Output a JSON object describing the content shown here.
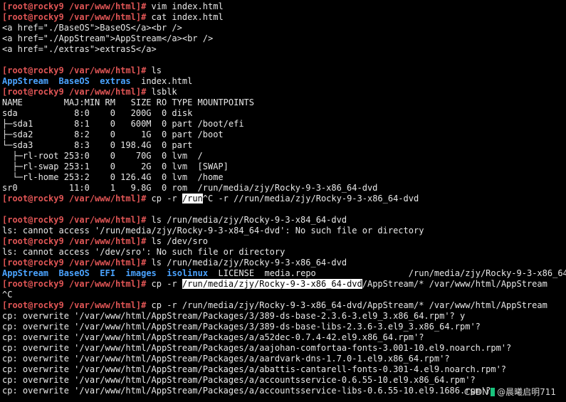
{
  "terminal": {
    "lines": [
      {
        "segments": [
          {
            "text": "[root@rocky9 /var/www/html]#",
            "style": "prompt"
          },
          {
            "text": " vim index.html"
          }
        ]
      },
      {
        "segments": [
          {
            "text": "[root@rocky9 /var/www/html]#",
            "style": "prompt"
          },
          {
            "text": " cat index.html"
          }
        ]
      },
      {
        "segments": [
          {
            "text": "<a href=\"./BaseOS\">BaseOS</a><br />"
          }
        ]
      },
      {
        "segments": [
          {
            "text": "<a href=\"./AppStream\">AppStream</a><br />"
          }
        ]
      },
      {
        "segments": [
          {
            "text": "<a href=\"./extras\">extrasS</a>"
          }
        ]
      },
      {
        "segments": []
      },
      {
        "segments": [
          {
            "text": "[root@rocky9 /var/www/html]#",
            "style": "prompt"
          },
          {
            "text": " ls"
          }
        ]
      },
      {
        "segments": [
          {
            "text": "AppStream",
            "style": "dir"
          },
          {
            "text": "  "
          },
          {
            "text": "BaseOS",
            "style": "dir"
          },
          {
            "text": "  "
          },
          {
            "text": "extras",
            "style": "dir"
          },
          {
            "text": "  index.html"
          }
        ]
      },
      {
        "segments": [
          {
            "text": "[root@rocky9 /var/www/html]#",
            "style": "prompt"
          },
          {
            "text": " lsblk"
          }
        ]
      },
      {
        "segments": [
          {
            "text": "NAME        MAJ:MIN RM   SIZE RO TYPE MOUNTPOINTS"
          }
        ]
      },
      {
        "segments": [
          {
            "text": "sda           8:0    0   200G  0 disk"
          }
        ]
      },
      {
        "segments": [
          {
            "text": "├─sda1        8:1    0   600M  0 part /boot/efi"
          }
        ]
      },
      {
        "segments": [
          {
            "text": "├─sda2        8:2    0     1G  0 part /boot"
          }
        ]
      },
      {
        "segments": [
          {
            "text": "└─sda3        8:3    0 198.4G  0 part"
          }
        ]
      },
      {
        "segments": [
          {
            "text": "  ├─rl-root 253:0    0    70G  0 lvm  /"
          }
        ]
      },
      {
        "segments": [
          {
            "text": "  ├─rl-swap 253:1    0     2G  0 lvm  [SWAP]"
          }
        ]
      },
      {
        "segments": [
          {
            "text": "  └─rl-home 253:2    0 126.4G  0 lvm  /home"
          }
        ]
      },
      {
        "segments": [
          {
            "text": "sr0          11:0    1   9.8G  0 rom  /run/media/zjy/Rocky-9-3-x86_64-dvd"
          }
        ]
      },
      {
        "segments": [
          {
            "text": "[root@rocky9 /var/www/html]#",
            "style": "prompt"
          },
          {
            "text": " cp -r "
          },
          {
            "text": "/run",
            "style": "sel"
          },
          {
            "text": "^C -r //run/media/zjy/Rocky-9-3-x86_64-dvd"
          }
        ]
      },
      {
        "segments": []
      },
      {
        "segments": [
          {
            "text": "[root@rocky9 /var/www/html]#",
            "style": "prompt"
          },
          {
            "text": " ls /run/media/zjy/Rocky-9-3-x84_64-dvd"
          }
        ]
      },
      {
        "segments": [
          {
            "text": "ls: cannot access '/run/media/zjy/Rocky-9-3-x84_64-dvd': No such file or directory"
          }
        ]
      },
      {
        "segments": [
          {
            "text": "[root@rocky9 /var/www/html]#",
            "style": "prompt"
          },
          {
            "text": " ls /dev/sro"
          }
        ]
      },
      {
        "segments": [
          {
            "text": "ls: cannot access '/dev/sro': No such file or directory"
          }
        ]
      },
      {
        "segments": [
          {
            "text": "[root@rocky9 /var/www/html]#",
            "style": "prompt"
          },
          {
            "text": " ls /run/media/zjy/Rocky-9-3-x86_64-dvd"
          }
        ]
      },
      {
        "segments": [
          {
            "text": "AppStream",
            "style": "dir"
          },
          {
            "text": "  "
          },
          {
            "text": "BaseOS",
            "style": "dir"
          },
          {
            "text": "  "
          },
          {
            "text": "EFI",
            "style": "dir"
          },
          {
            "text": "  "
          },
          {
            "text": "images",
            "style": "dir"
          },
          {
            "text": "  "
          },
          {
            "text": "isolinux",
            "style": "dir"
          },
          {
            "text": "  LICENSE  media.repo                  /run/media/zjy/Rocky-9-3-x86_64-dvd"
          }
        ]
      },
      {
        "segments": [
          {
            "text": "[root@rocky9 /var/www/html]#",
            "style": "prompt"
          },
          {
            "text": " cp -r "
          },
          {
            "text": "/run/media/zjy/Rocky-9-3-x86_64-dvd",
            "style": "sel"
          },
          {
            "text": "/AppStream/* /var/www/html/AppStream"
          }
        ]
      },
      {
        "segments": [
          {
            "text": "^C"
          }
        ]
      },
      {
        "segments": [
          {
            "text": "[root@rocky9 /var/www/html]#",
            "style": "prompt"
          },
          {
            "text": " cp -r /run/media/zjy/Rocky-9-3-x86_64-dvd/AppStream/* /var/www/html/AppStream"
          }
        ]
      },
      {
        "segments": [
          {
            "text": "cp: overwrite '/var/www/html/AppStream/Packages/3/389-ds-base-2.3.6-3.el9_3.x86_64.rpm'? y"
          }
        ]
      },
      {
        "segments": [
          {
            "text": "cp: overwrite '/var/www/html/AppStream/Packages/3/389-ds-base-libs-2.3.6-3.el9_3.x86_64.rpm'?"
          }
        ]
      },
      {
        "segments": [
          {
            "text": "cp: overwrite '/var/www/html/AppStream/Packages/a/a52dec-0.7.4-42.el9.x86_64.rpm'?"
          }
        ]
      },
      {
        "segments": [
          {
            "text": "cp: overwrite '/var/www/html/AppStream/Packages/a/aajohan-comfortaa-fonts-3.001-10.el9.noarch.rpm'?"
          }
        ]
      },
      {
        "segments": [
          {
            "text": "cp: overwrite '/var/www/html/AppStream/Packages/a/aardvark-dns-1.7.0-1.el9.x86_64.rpm'?"
          }
        ]
      },
      {
        "segments": [
          {
            "text": "cp: overwrite '/var/www/html/AppStream/Packages/a/abattis-cantarell-fonts-0.301-4.el9.noarch.rpm'?"
          }
        ]
      },
      {
        "segments": [
          {
            "text": "cp: overwrite '/var/www/html/AppStream/Packages/a/accountsservice-0.6.55-10.el9.x86_64.rpm'?"
          }
        ]
      },
      {
        "segments": [
          {
            "text": "cp: overwrite '/var/www/html/AppStream/Packages/a/accountsservice-libs-0.6.55-10.el9.1686.rpm'?"
          }
        ]
      }
    ]
  },
  "watermark": {
    "left_text": "CSDN",
    "right_text": "@晨曦启明711"
  }
}
